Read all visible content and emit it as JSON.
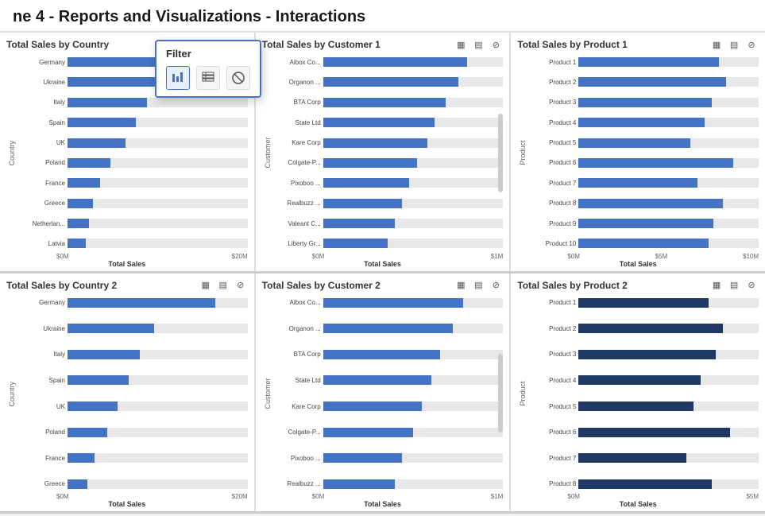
{
  "title": "ne 4 - Reports and Visualizations - Interactions",
  "filter_popup": {
    "title": "Filter",
    "icon1": "▤",
    "icon2": "▦",
    "icon3": "⊘"
  },
  "row1": {
    "panel1": {
      "title": "Total Sales by Country",
      "y_label": "Country",
      "x_label": "Total Sales",
      "x_ticks": [
        "$0M",
        "$20M"
      ],
      "bars": [
        {
          "label": "Germany",
          "pct": 82
        },
        {
          "label": "Ukraine",
          "pct": 55
        },
        {
          "label": "Italy",
          "pct": 44
        },
        {
          "label": "Spain",
          "pct": 38
        },
        {
          "label": "UK",
          "pct": 32
        },
        {
          "label": "Poland",
          "pct": 24
        },
        {
          "label": "France",
          "pct": 18
        },
        {
          "label": "Greece",
          "pct": 14
        },
        {
          "label": "Netherlan...",
          "pct": 12
        },
        {
          "label": "Latvia",
          "pct": 10
        }
      ],
      "color": "blue"
    },
    "panel2": {
      "title": "Total Sales by Customer 1",
      "y_label": "Customer",
      "x_label": "Total Sales",
      "x_ticks": [
        "$0M",
        "$1M"
      ],
      "bars": [
        {
          "label": "Aibox Co...",
          "pct": 80
        },
        {
          "label": "Organon ...",
          "pct": 75
        },
        {
          "label": "BTA Corp",
          "pct": 68
        },
        {
          "label": "State Ltd",
          "pct": 62
        },
        {
          "label": "Kare Corp",
          "pct": 58
        },
        {
          "label": "Colgate-P...",
          "pct": 52
        },
        {
          "label": "Pixoboo ...",
          "pct": 48
        },
        {
          "label": "Realbuzz ...",
          "pct": 44
        },
        {
          "label": "Valeant C...",
          "pct": 40
        },
        {
          "label": "Liberty Gr...",
          "pct": 36
        }
      ],
      "color": "blue"
    },
    "panel3": {
      "title": "Total Sales by Product 1",
      "y_label": "Product",
      "x_label": "Total Sales",
      "x_ticks": [
        "$0M",
        "$5M",
        "$10M"
      ],
      "bars": [
        {
          "label": "Product 1",
          "pct": 78
        },
        {
          "label": "Product 2",
          "pct": 82
        },
        {
          "label": "Product 3",
          "pct": 74
        },
        {
          "label": "Product 4",
          "pct": 70
        },
        {
          "label": "Product 5",
          "pct": 62
        },
        {
          "label": "Product 6",
          "pct": 86
        },
        {
          "label": "Product 7",
          "pct": 66
        },
        {
          "label": "Product 8",
          "pct": 80
        },
        {
          "label": "Product 9",
          "pct": 75
        },
        {
          "label": "Product 10",
          "pct": 72
        }
      ],
      "color": "blue"
    }
  },
  "row2": {
    "panel1": {
      "title": "Total Sales by Country 2",
      "y_label": "Country",
      "x_label": "Total Sales",
      "x_ticks": [
        "$0M",
        "$20M"
      ],
      "bars": [
        {
          "label": "Germany",
          "pct": 82
        },
        {
          "label": "Ukraine",
          "pct": 48
        },
        {
          "label": "Italy",
          "pct": 40
        },
        {
          "label": "Spain",
          "pct": 34
        },
        {
          "label": "UK",
          "pct": 28
        },
        {
          "label": "Poland",
          "pct": 22
        },
        {
          "label": "France",
          "pct": 15
        },
        {
          "label": "Greece",
          "pct": 11
        }
      ],
      "color": "blue"
    },
    "panel2": {
      "title": "Total Sales by Customer 2",
      "y_label": "Customer",
      "x_label": "Total Sales",
      "x_ticks": [
        "$0M",
        "$1M"
      ],
      "bars": [
        {
          "label": "Aibox Co...",
          "pct": 78
        },
        {
          "label": "Organon ...",
          "pct": 72
        },
        {
          "label": "BTA Corp",
          "pct": 65
        },
        {
          "label": "State Ltd",
          "pct": 60
        },
        {
          "label": "Kare Corp",
          "pct": 55
        },
        {
          "label": "Colgate-P...",
          "pct": 50
        },
        {
          "label": "Pixoboo ...",
          "pct": 44
        },
        {
          "label": "Realbuzz ...",
          "pct": 40
        }
      ],
      "color": "blue"
    },
    "panel3": {
      "title": "Total Sales by Product 2",
      "y_label": "Product",
      "x_label": "Total Sales",
      "x_ticks": [
        "$0M",
        "$5M"
      ],
      "bars": [
        {
          "label": "Product 1",
          "pct": 72
        },
        {
          "label": "Product 2",
          "pct": 80
        },
        {
          "label": "Product 3",
          "pct": 76
        },
        {
          "label": "Product 4",
          "pct": 68
        },
        {
          "label": "Product 5",
          "pct": 64
        },
        {
          "label": "Product 6",
          "pct": 84
        },
        {
          "label": "Product 7",
          "pct": 60
        },
        {
          "label": "Product 8",
          "pct": 74
        }
      ],
      "color": "darkblue"
    }
  }
}
